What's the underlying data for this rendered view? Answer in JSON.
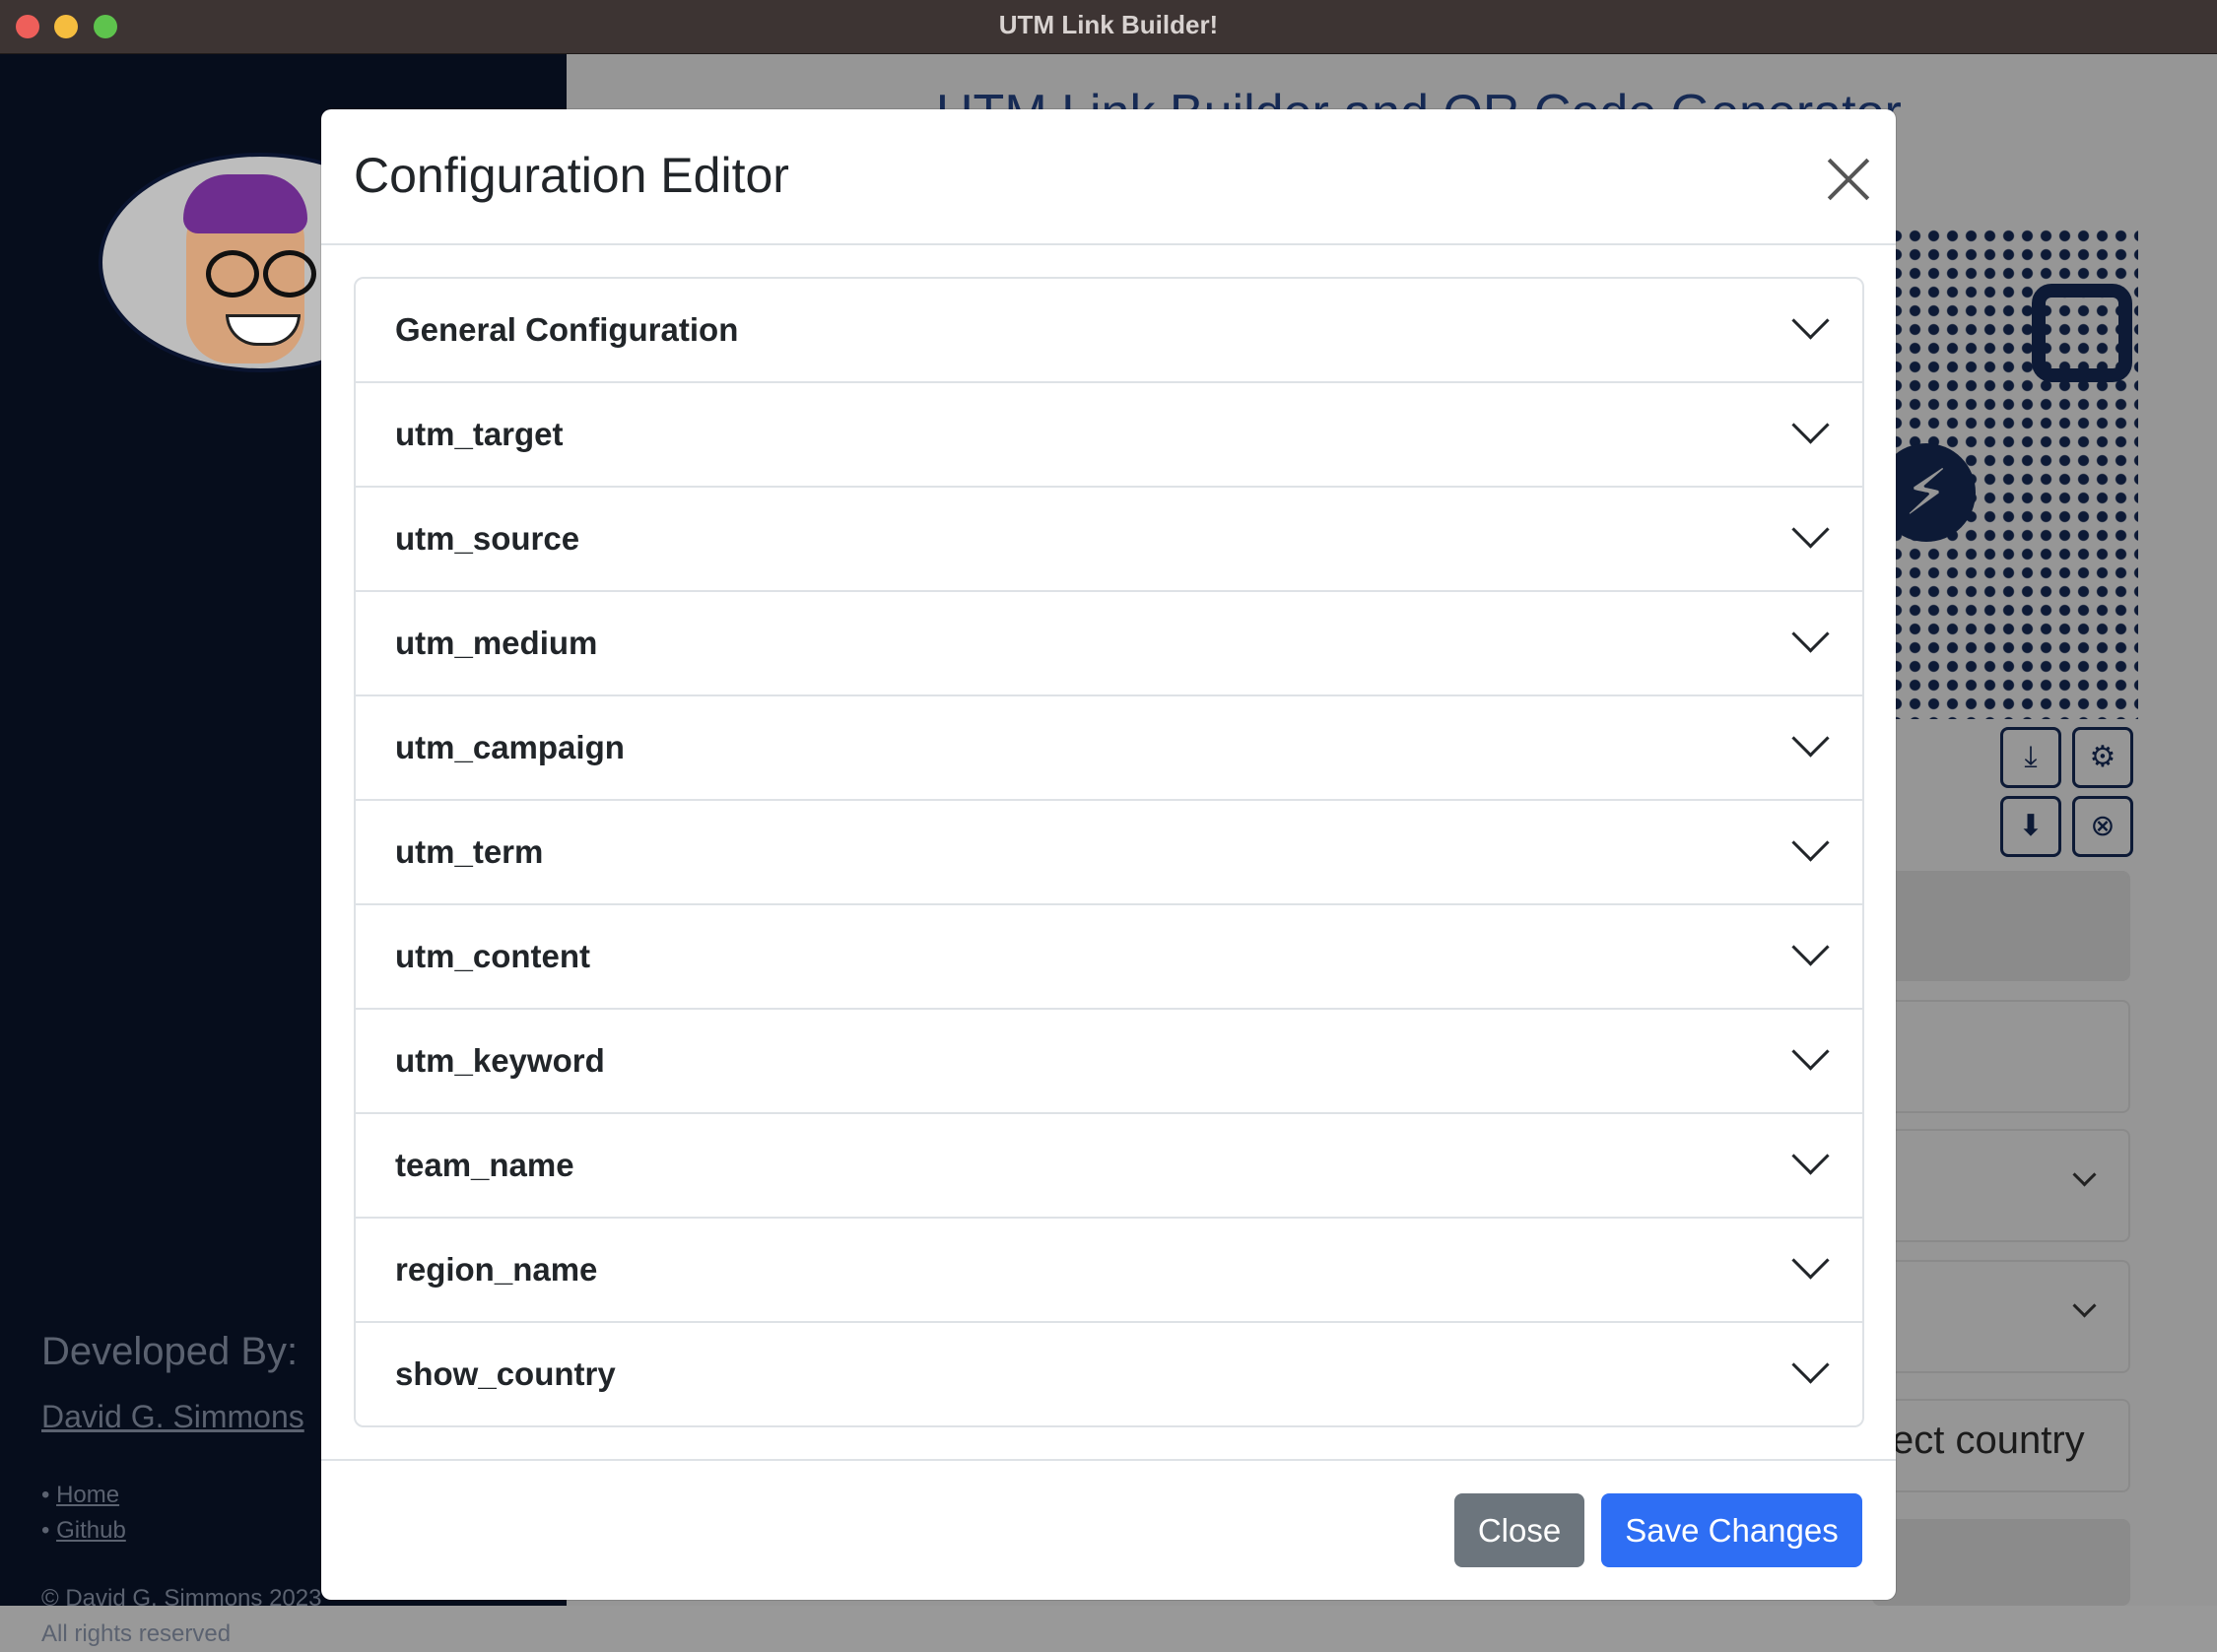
{
  "window": {
    "title": "UTM Link Builder!"
  },
  "background": {
    "main_title": "UTM Link Builder and QR Code Generator",
    "sidebar": {
      "developed_by": "Developed By:",
      "developer_name": "David G. Simmons",
      "links": [
        "Home",
        "Github"
      ],
      "copyright": "© David G. Simmons 2023",
      "rights": "All rights reserved"
    },
    "country_placeholder": "ect country",
    "qr_buttons": [
      "download-icon",
      "gear-icon",
      "download-box-icon",
      "close-circle-icon"
    ]
  },
  "modal": {
    "title": "Configuration Editor",
    "sections": [
      "General Configuration",
      "utm_target",
      "utm_source",
      "utm_medium",
      "utm_campaign",
      "utm_term",
      "utm_content",
      "utm_keyword",
      "team_name",
      "region_name",
      "show_country"
    ],
    "close_label": "Close",
    "save_label": "Save Changes"
  },
  "colors": {
    "primary": "#2e6ef4",
    "secondary": "#6c757d",
    "sidebar_bg": "#060d1c",
    "titlebar_bg": "#3d3433"
  }
}
